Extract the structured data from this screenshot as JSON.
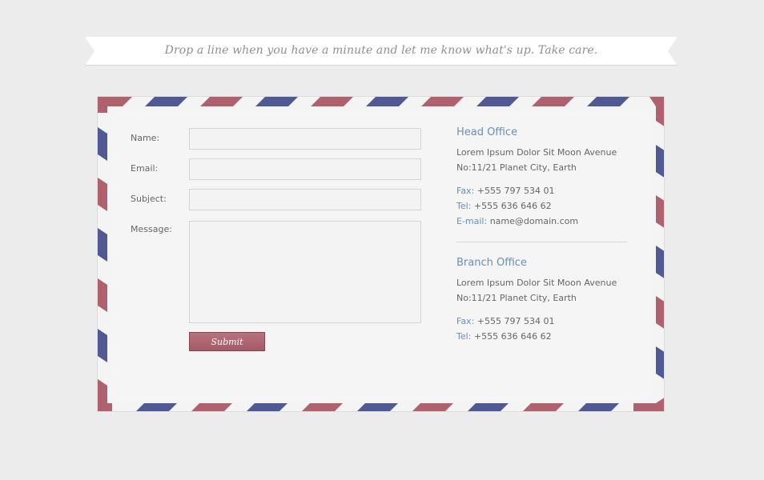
{
  "banner": {
    "text": "Drop a line when you have a minute and let me know what's up. Take care."
  },
  "form": {
    "name_label": "Name:",
    "email_label": "Email:",
    "subject_label": "Subject:",
    "message_label": "Message:",
    "name_value": "",
    "email_value": "",
    "subject_value": "",
    "message_value": "",
    "submit_label": "Submit"
  },
  "head_office": {
    "title": "Head Office",
    "address_line1": "Lorem Ipsum Dolor Sit Moon Avenue",
    "address_line2": "No:11/21 Planet City, Earth",
    "fax_label": "Fax:",
    "fax_value": "+555 797 534 01",
    "tel_label": "Tel:",
    "tel_value": "+555 636 646 62",
    "email_label": "E-mail:",
    "email_value": "name@domain.com"
  },
  "branch_office": {
    "title": "Branch Office",
    "address_line1": "Lorem Ipsum Dolor Sit Moon Avenue",
    "address_line2": "No:11/21 Planet City, Earth",
    "fax_label": "Fax:",
    "fax_value": "+555 797 534 01",
    "tel_label": "Tel:",
    "tel_value": "+555 636 646 62"
  },
  "colors": {
    "background": "#ececec",
    "envelope": "#f4f4f4",
    "stripe_red": "#b0616e",
    "stripe_blue": "#4f5a94",
    "accent_blue": "#6a8fb3",
    "button": "#a45a66"
  }
}
